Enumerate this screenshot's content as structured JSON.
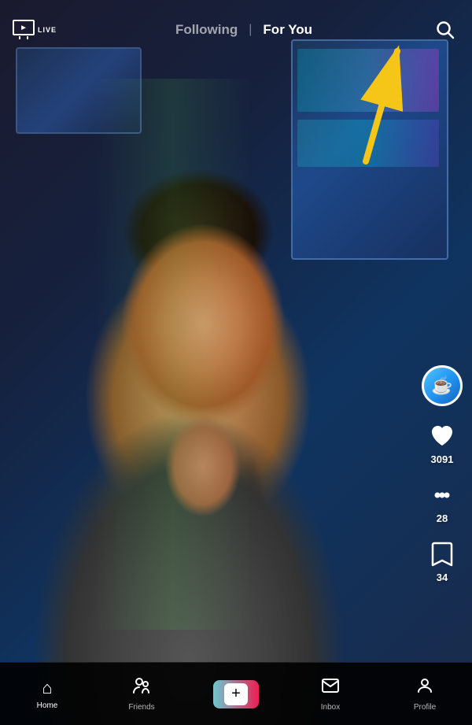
{
  "header": {
    "live_label": "LIVE",
    "following_label": "Following",
    "foryou_label": "For You",
    "divider": "|"
  },
  "actions": {
    "likes_count": "3091",
    "comments_count": "28",
    "bookmarks_count": "34"
  },
  "bottom_nav": {
    "home_label": "Home",
    "friends_label": "Friends",
    "inbox_label": "Inbox",
    "profile_label": "Profile"
  },
  "colors": {
    "accent_yellow": "#F5C518",
    "active_white": "#FFFFFF",
    "inactive_white": "rgba(255,255,255,0.6)"
  },
  "avatar": {
    "emoji": "☕"
  }
}
